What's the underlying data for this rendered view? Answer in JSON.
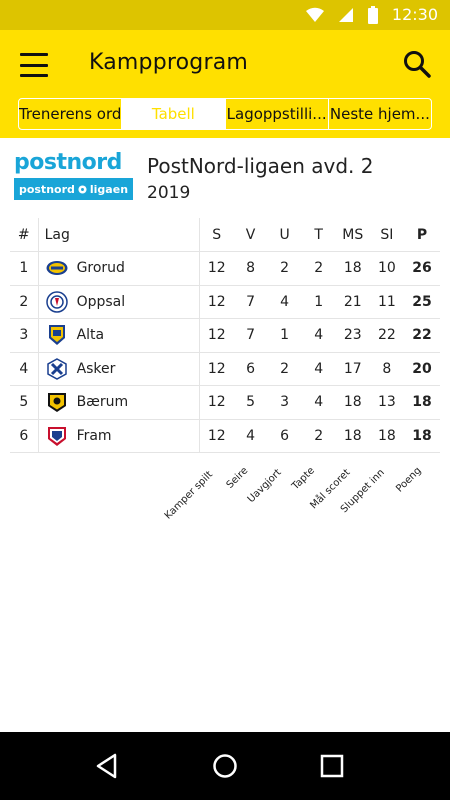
{
  "status_bar": {
    "time": "12:30"
  },
  "app_bar": {
    "title": "Kampprogram"
  },
  "tabs": [
    {
      "label": "Trenerens ord",
      "active": false
    },
    {
      "label": "Tabell",
      "active": true
    },
    {
      "label": "Lagoppstilli...",
      "active": false
    },
    {
      "label": "Neste hjem...",
      "active": false
    }
  ],
  "league": {
    "logo_text": "postnord",
    "logo_subtext": "postnord",
    "logo_subtext_2": "ligaen",
    "name": "PostNord-ligaen avd. 2",
    "year": "2019"
  },
  "table": {
    "headers": {
      "rank": "#",
      "team": "Lag",
      "s": "S",
      "v": "V",
      "u": "U",
      "t": "T",
      "ms": "MS",
      "si": "SI",
      "p": "P"
    },
    "rows": [
      {
        "rank": "1",
        "team": "Grorud",
        "crest": "grorud-crest-icon",
        "s": "12",
        "v": "8",
        "u": "2",
        "t": "2",
        "ms": "18",
        "si": "10",
        "p": "26"
      },
      {
        "rank": "2",
        "team": "Oppsal",
        "crest": "oppsal-crest-icon",
        "s": "12",
        "v": "7",
        "u": "4",
        "t": "1",
        "ms": "21",
        "si": "11",
        "p": "25"
      },
      {
        "rank": "3",
        "team": "Alta",
        "crest": "alta-crest-icon",
        "s": "12",
        "v": "7",
        "u": "1",
        "t": "4",
        "ms": "23",
        "si": "22",
        "p": "22"
      },
      {
        "rank": "4",
        "team": "Asker",
        "crest": "asker-crest-icon",
        "s": "12",
        "v": "6",
        "u": "2",
        "t": "4",
        "ms": "17",
        "si": "8",
        "p": "20"
      },
      {
        "rank": "5",
        "team": "Bærum",
        "crest": "baerum-crest-icon",
        "s": "12",
        "v": "5",
        "u": "3",
        "t": "4",
        "ms": "18",
        "si": "13",
        "p": "18"
      },
      {
        "rank": "6",
        "team": "Fram",
        "crest": "fram-crest-icon",
        "s": "12",
        "v": "4",
        "u": "6",
        "t": "2",
        "ms": "18",
        "si": "18",
        "p": "18"
      }
    ]
  },
  "legend": {
    "s": "Kamper spilt",
    "v": "Seire",
    "u": "Uavgjort",
    "t": "Tapte",
    "ms": "Mål scoret",
    "si": "Sluppet inn",
    "p": "Poeng"
  },
  "colors": {
    "accent": "#ffe000",
    "status_bar": "#ddc400",
    "logo_blue": "#19a5d8"
  }
}
